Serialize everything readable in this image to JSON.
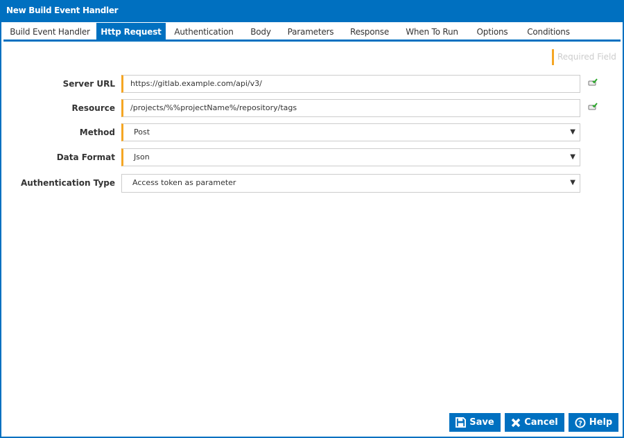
{
  "window": {
    "title": "New Build Event Handler"
  },
  "tabs": [
    {
      "label": "Build Event Handler"
    },
    {
      "label": "Http Request",
      "active": true
    },
    {
      "label": "Authentication"
    },
    {
      "label": "Body"
    },
    {
      "label": "Parameters"
    },
    {
      "label": "Response"
    },
    {
      "label": "When To Run"
    },
    {
      "label": "Options"
    },
    {
      "label": "Conditions"
    }
  ],
  "legend": {
    "required": "Required Field"
  },
  "form": {
    "server_url": {
      "label": "Server URL",
      "value": "https://gitlab.example.com/api/v3/"
    },
    "resource": {
      "label": "Resource",
      "value": "/projects/%%projectName%/repository/tags"
    },
    "method": {
      "label": "Method",
      "value": "Post"
    },
    "data_format": {
      "label": "Data Format",
      "value": "Json"
    },
    "auth_type": {
      "label": "Authentication Type",
      "value": "Access token as parameter"
    }
  },
  "buttons": {
    "save": "Save",
    "cancel": "Cancel",
    "help": "Help"
  },
  "colors": {
    "accent": "#0070c0",
    "required": "#f5a623"
  }
}
